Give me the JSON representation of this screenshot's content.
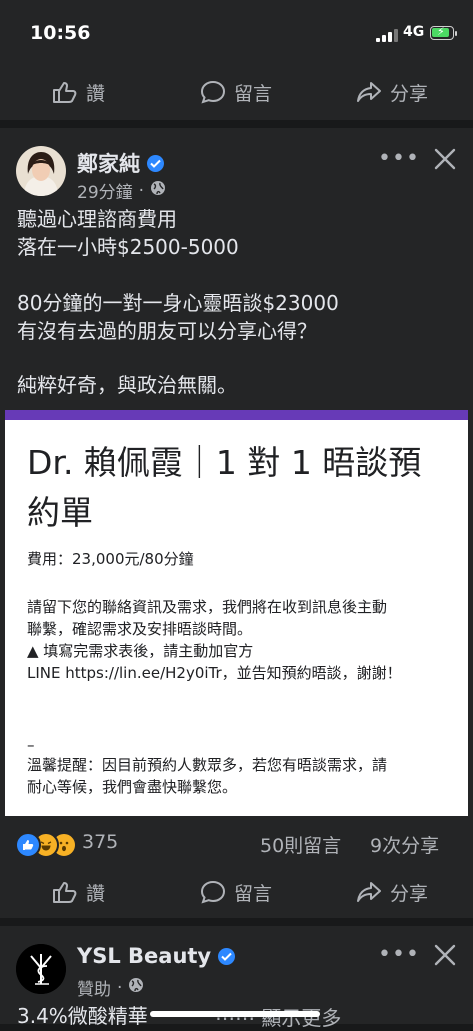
{
  "status_bar": {
    "time": "10:56",
    "network": "4G"
  },
  "action_bar": {
    "like": "讚",
    "comment": "留言",
    "share": "分享"
  },
  "post": {
    "author": "鄭家純",
    "time": "29分鐘",
    "separator": "·",
    "text_lines": [
      "聽過心理諮商費用",
      "落在一小時$2500-5000",
      "",
      "80分鐘的一對一身心靈晤談$23000",
      "有沒有去過的朋友可以分享心得？",
      "",
      "純粹好奇，與政治無關。"
    ],
    "form": {
      "title": "Dr. 賴佩霞｜1 對 1 晤談預約單",
      "fee": "費用：23,000元/80分鐘",
      "body_lines": [
        "請留下您的聯絡資訊及需求，我們將在收到訊息後主動",
        "聯繫，確認需求及安排晤談時間。",
        "▲ 填寫完需求表後，請主動加官方",
        "LINE https://lin.ee/H2y0iTr，並告知預約晤談，謝謝！"
      ],
      "dash": "–",
      "notice_lines": [
        "溫馨提醒：因目前預約人數眾多，若您有晤談需求，請",
        "耐心等候，我們會盡快聯繫您。"
      ]
    },
    "reaction_count": "375",
    "comment_count": "50則留言",
    "share_count": "9次分享"
  },
  "ad": {
    "author": "YSL Beauty",
    "sponsored": "贊助",
    "separator": "·",
    "text": "3.4%微酸精華",
    "see_more": "⋯⋯ 顯示更多"
  },
  "colors": {
    "verified": "#2d88ff",
    "form_accent": "#673ab7",
    "background": "#18191a",
    "card": "#242526"
  },
  "icons": [
    "like-icon",
    "comment-icon",
    "share-icon",
    "verified-icon",
    "globe-icon",
    "more-icon",
    "close-icon",
    "like-reaction-icon",
    "haha-reaction-icon",
    "wow-reaction-icon"
  ]
}
